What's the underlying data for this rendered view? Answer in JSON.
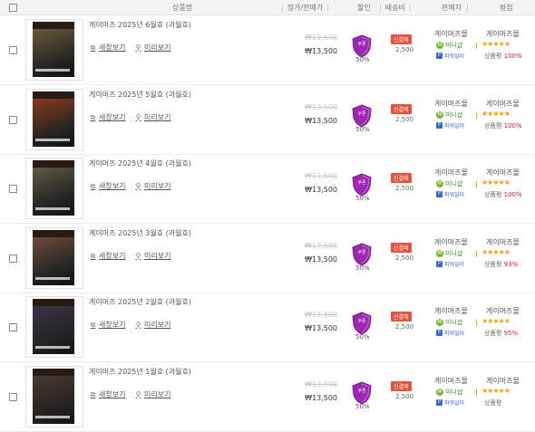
{
  "header": {
    "product": "상품명",
    "price": "정가/판매가",
    "discount": "할인",
    "shipping": "배송비",
    "seller": "판매자",
    "rating": "평점"
  },
  "rows": [
    {
      "title": "게이머즈 2025년 6월호 (과월호)",
      "orig": "₩13,500",
      "price": "₩13,500",
      "coupon": "쿠폰",
      "rate": "50%",
      "badge": "신결제",
      "ship": "2,500",
      "seller": "게이머즈몰",
      "mini": "미니샵",
      "power": "파워딜러",
      "store": "게이머즈몰",
      "stars": "★★★★★",
      "score_label": "상품평",
      "score": "100%",
      "coverColor": "#6b5a3a"
    },
    {
      "title": "게이머즈 2025년 5월호 (과월호)",
      "orig": "₩13,500",
      "price": "₩13,500",
      "coupon": "쿠폰",
      "rate": "50%",
      "badge": "신결제",
      "ship": "2,500",
      "seller": "게이머즈몰",
      "mini": "미니샵",
      "power": "파워딜러",
      "store": "게이머즈몰",
      "stars": "★★★★★",
      "score_label": "상품평",
      "score": "100%",
      "coverColor": "#8a3a1e"
    },
    {
      "title": "게이머즈 2025년 4월호 (과월호)",
      "orig": "₩13,500",
      "price": "₩13,500",
      "coupon": "쿠폰",
      "rate": "50%",
      "badge": "신결제",
      "ship": "2,500",
      "seller": "게이머즈몰",
      "mini": "미니샵",
      "power": "파워딜러",
      "store": "게이머즈몰",
      "stars": "★★★★★",
      "score_label": "상품평",
      "score": "100%",
      "coverColor": "#5b5a42"
    },
    {
      "title": "게이머즈 2025년 3월호 (과월호)",
      "orig": "₩13,500",
      "price": "₩13,500",
      "coupon": "쿠폰",
      "rate": "50%",
      "badge": "신결제",
      "ship": "2,500",
      "seller": "게이머즈몰",
      "mini": "미니샵",
      "power": "파워딜러",
      "store": "게이머즈몰",
      "stars": "★★★★★",
      "score_label": "상품평",
      "score": "93%",
      "coverColor": "#6e4a3a"
    },
    {
      "title": "게이머즈 2025년 2월호 (과월호)",
      "orig": "₩13,500",
      "price": "₩13,500",
      "coupon": "쿠폰",
      "rate": "50%",
      "badge": "신결제",
      "ship": "2,500",
      "seller": "게이머즈몰",
      "mini": "미니샵",
      "power": "파워딜러",
      "store": "게이머즈몰",
      "stars": "★★★★★",
      "score_label": "상품평",
      "score": "95%",
      "coverColor": "#3a3446"
    },
    {
      "title": "게이머즈 2025년 1월호 (과월호)",
      "orig": "₩13,500",
      "price": "₩13,500",
      "coupon": "쿠폰",
      "rate": "50%",
      "badge": "신결제",
      "ship": "2,500",
      "seller": "게이머즈몰",
      "mini": "미니샵",
      "power": "파워딜러",
      "store": "게이머즈몰",
      "stars": "★★★★★",
      "score_label": "상품평",
      "score": "",
      "coverColor": "#4a3a2e"
    }
  ],
  "actions": {
    "detail": "새창보기",
    "preview": "미리보기"
  },
  "colors": {
    "accent": "#9c27b0",
    "badge": "#e5533c",
    "star": "#f2a100",
    "score": "#c2185b"
  }
}
